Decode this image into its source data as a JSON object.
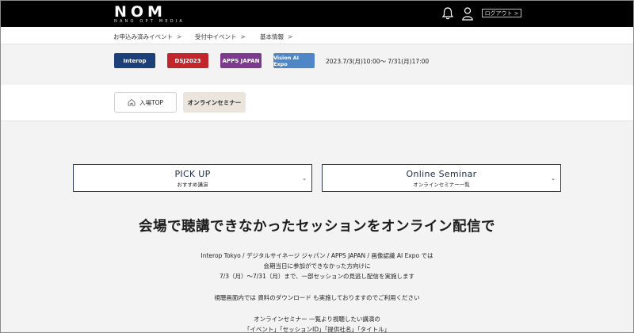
{
  "header": {
    "logo_main": "NOM",
    "logo_sub": "NANO OPT MEDIA",
    "logout_label": "ログアウト",
    "logout_chevron": ">"
  },
  "breadcrumb": {
    "items": [
      {
        "label": "お申込み済みイベント",
        "sep": ">"
      },
      {
        "label": "受付中イベント",
        "sep": ">"
      },
      {
        "label": "基本情報",
        "sep": ">"
      }
    ]
  },
  "events": {
    "badges": [
      {
        "label": "Interop"
      },
      {
        "label": "DSJ2023"
      },
      {
        "label": "APPS JAPAN"
      },
      {
        "label": "Vision AI Expo"
      }
    ],
    "period": "2023.7/3(月)10:00～ 7/31(月)17:00"
  },
  "tabs": {
    "top_label": "入場TOP",
    "online_label": "オンラインセミナー"
  },
  "selectors": {
    "pickup_title": "PICK UP",
    "pickup_sub": "おすすめ講演",
    "online_title": "Online Seminar",
    "online_sub": "オンラインセミナー一覧",
    "chevron": "⌄"
  },
  "main": {
    "headline": "会場で聴講できなかったセッションをオンライン配信で",
    "line1": "Interop Tokyo / デジタルサイネージ ジャパン / APPS JAPAN / 画像認識 AI Expo では",
    "line2": "会期当日に参加ができなかった方向けに",
    "line3": "7/3（月）～7/31（月）まで、一部セッションの見逃し配信を実施します",
    "line4": "視聴画面内では 資料のダウンロード も実施しておりますのでご利用ください",
    "line5": "オンラインセミナー 一覧より視聴したい講演の",
    "line6": "「イベント」「セッションID」「提供社名」「タイトル」"
  },
  "colors": {
    "header_bg": "#000000",
    "tab_active_bg": "#ebe5dd",
    "selector_border": "#2b3b5a",
    "interop": "#1d3f7a",
    "dsj": "#c3252c",
    "apps": "#7c3a8e",
    "vision": "#4f86c6"
  }
}
